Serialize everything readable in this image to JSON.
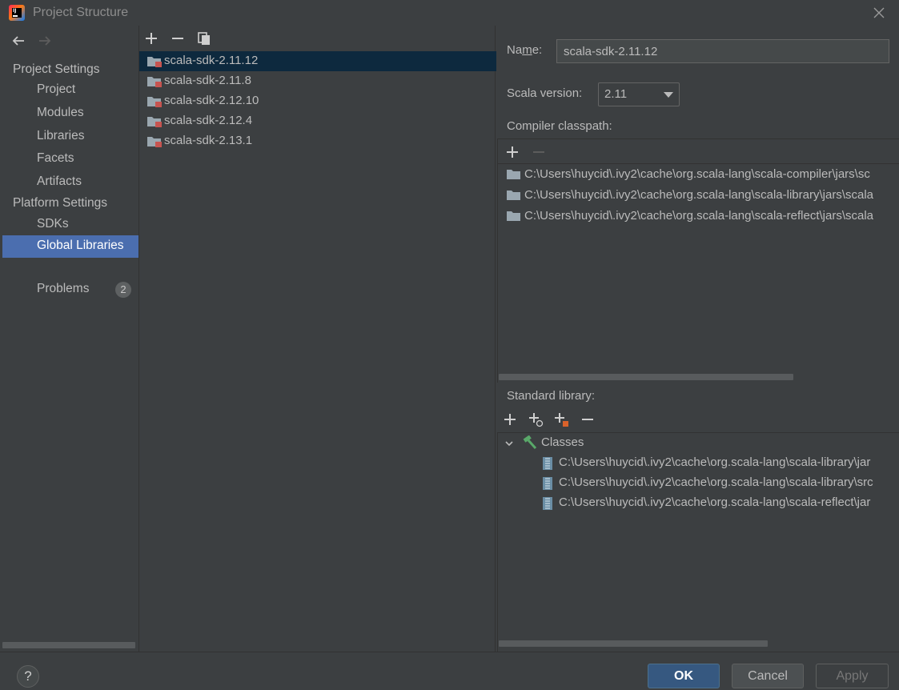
{
  "window": {
    "title": "Project Structure"
  },
  "nav": {
    "project_settings_label": "Project Settings",
    "project_items": [
      "Project",
      "Modules",
      "Libraries",
      "Facets",
      "Artifacts"
    ],
    "platform_settings_label": "Platform Settings",
    "platform_items": [
      "SDKs",
      "Global Libraries"
    ],
    "selected": "Global Libraries",
    "problems_label": "Problems",
    "problems_count": "2"
  },
  "libraries": {
    "items": [
      "scala-sdk-2.11.12",
      "scala-sdk-2.11.8",
      "scala-sdk-2.12.10",
      "scala-sdk-2.12.4",
      "scala-sdk-2.13.1"
    ],
    "selected": "scala-sdk-2.11.12"
  },
  "detail": {
    "name_label_pre": "Na",
    "name_label_mnemonic": "m",
    "name_label_post": "e:",
    "name_value": "scala-sdk-2.11.12",
    "scala_version_label": "Scala version:",
    "scala_version_value": "2.11",
    "compiler_classpath_label": "Compiler classpath:",
    "compiler_classpath": [
      "C:\\Users\\huycid\\.ivy2\\cache\\org.scala-lang\\scala-compiler\\jars\\sc",
      "C:\\Users\\huycid\\.ivy2\\cache\\org.scala-lang\\scala-library\\jars\\scala",
      "C:\\Users\\huycid\\.ivy2\\cache\\org.scala-lang\\scala-reflect\\jars\\scala"
    ],
    "standard_library_label": "Standard library:",
    "classes_label": "Classes",
    "classes": [
      "C:\\Users\\huycid\\.ivy2\\cache\\org.scala-lang\\scala-library\\jar",
      "C:\\Users\\huycid\\.ivy2\\cache\\org.scala-lang\\scala-library\\src",
      "C:\\Users\\huycid\\.ivy2\\cache\\org.scala-lang\\scala-reflect\\jar"
    ]
  },
  "footer": {
    "help": "?",
    "ok": "OK",
    "cancel": "Cancel",
    "apply": "Apply"
  },
  "icons": {
    "app": "intellij-icon",
    "close": "close-icon",
    "back": "arrow-left-icon",
    "forward": "arrow-right-icon",
    "add": "plus-icon",
    "remove": "minus-icon",
    "copy": "copy-icon",
    "folder": "folder-icon",
    "jar": "jar-icon",
    "classes": "hammer-icon"
  },
  "colors": {
    "selection_nav": "#4b6eaf",
    "selection_list": "#0d293e",
    "ok_button": "#365880",
    "background": "#3c3f41"
  }
}
